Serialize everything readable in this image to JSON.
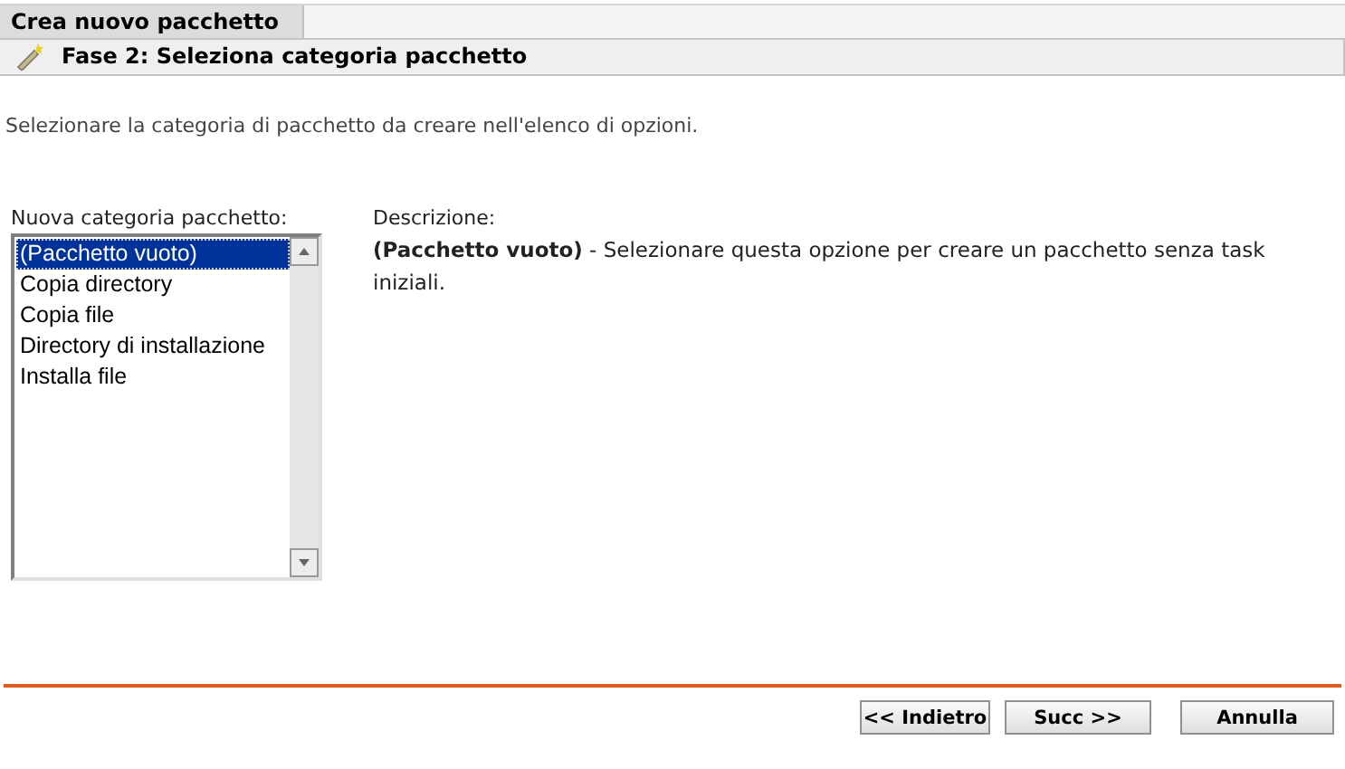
{
  "tab": {
    "title": "Crea nuovo pacchetto"
  },
  "step": {
    "title": "Fase 2: Seleziona categoria pacchetto"
  },
  "instruction": "Selezionare la categoria di pacchetto da creare nell'elenco di opzioni.",
  "category_list": {
    "label": "Nuova categoria pacchetto:",
    "items": [
      {
        "label": "(Pacchetto vuoto)",
        "selected": true
      },
      {
        "label": "Copia directory",
        "selected": false
      },
      {
        "label": "Copia file",
        "selected": false
      },
      {
        "label": "Directory di installazione",
        "selected": false
      },
      {
        "label": "Installa file",
        "selected": false
      }
    ]
  },
  "description": {
    "label": "Descrizione:",
    "text": "**(Pacchetto vuoto)** - Selezionare questa opzione per creare un pacchetto senza task iniziali."
  },
  "buttons": [
    {
      "label": "<< Indietro",
      "kind": "back"
    },
    {
      "label": "Succ >>",
      "kind": "next"
    },
    {
      "label": "Annulla",
      "kind": "cancel"
    }
  ]
}
